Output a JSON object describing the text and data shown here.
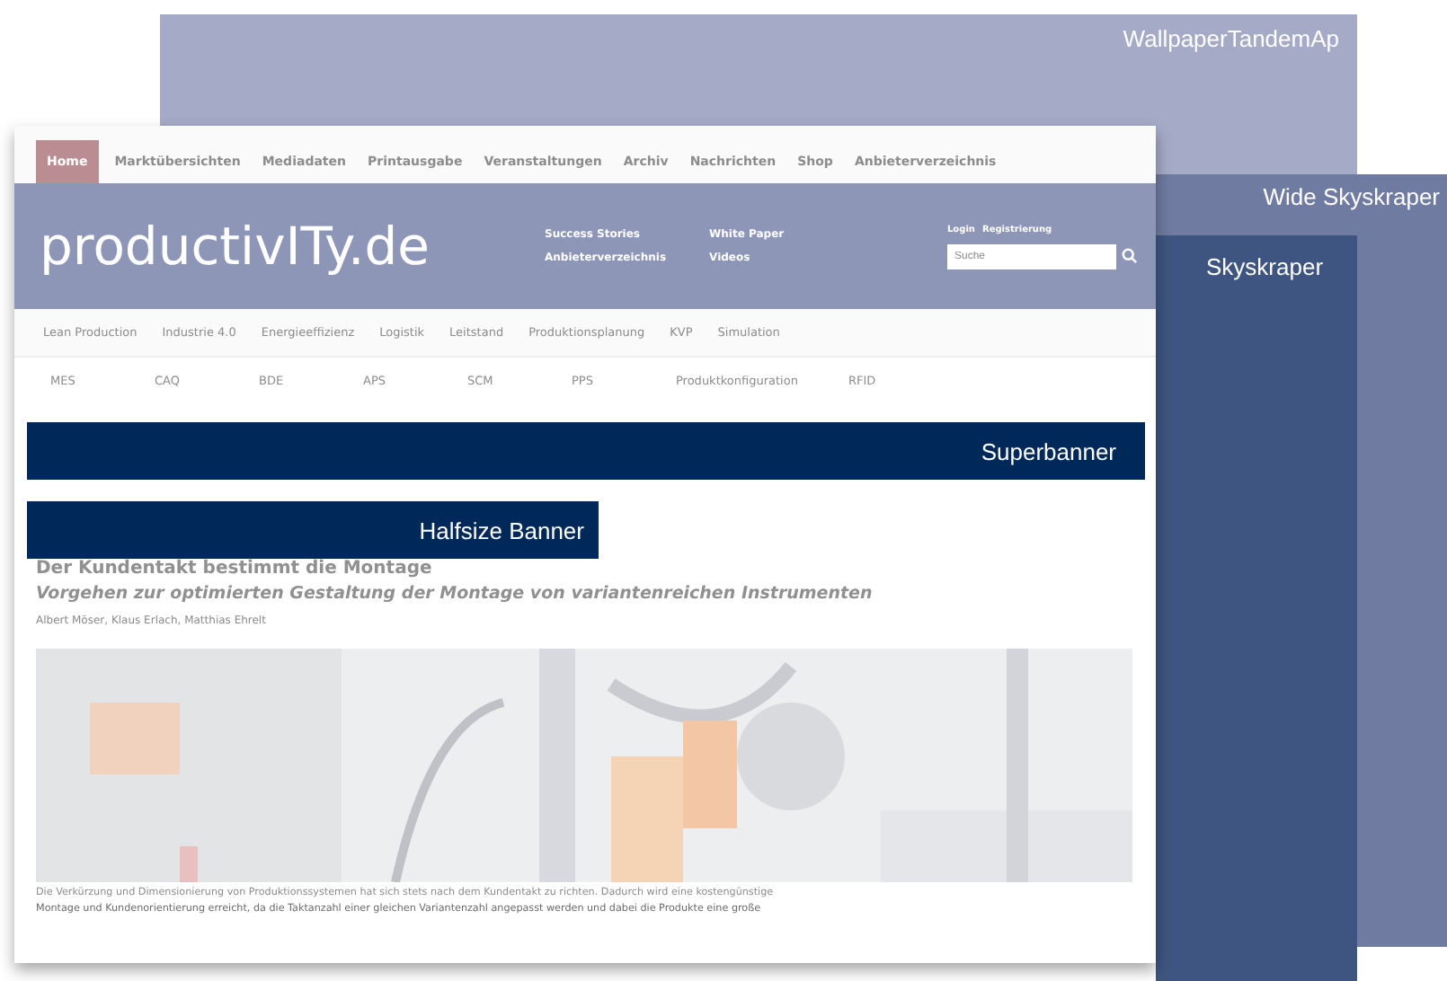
{
  "placements": [
    {
      "kind": "wallpaper",
      "label": "WallpaperTandemAp"
    },
    {
      "kind": "wide",
      "label": "Wide Skyskraper"
    },
    {
      "kind": "sky",
      "label": "Skyskraper"
    }
  ],
  "site": {
    "nav": [
      {
        "label": "Home",
        "selected": true
      },
      {
        "label": "Marktübersichten",
        "selected": false
      },
      {
        "label": "Mediadaten",
        "selected": false
      },
      {
        "label": "Printausgabe",
        "selected": false
      },
      {
        "label": "Veranstaltungen",
        "selected": false
      },
      {
        "label": "Archiv",
        "selected": false
      },
      {
        "label": "Nachrichten",
        "selected": false
      },
      {
        "label": "Shop",
        "selected": false
      },
      {
        "label": "Anbieterverzeichnis",
        "selected": false
      }
    ],
    "logo": "productivITy.de",
    "header_links": [
      "Success Stories",
      "White Paper",
      "Anbieterverzeichnis",
      "Videos"
    ],
    "account_links": [
      "Login",
      "Registrierung"
    ],
    "search": {
      "placeholder": "Suche"
    },
    "categories": [
      "Lean Production",
      "Industrie 4.0",
      "Energieeffizienz",
      "Logistik",
      "Leitstand",
      "Produktionsplanung",
      "KVP",
      "Simulation"
    ],
    "topics": [
      "MES",
      "CAQ",
      "BDE",
      "APS",
      "SCM",
      "PPS",
      "Produktkonfiguration",
      "RFID"
    ],
    "title": "Der Kundentakt bestimmt die Montage",
    "subtitle": "Vorgehen zur optimierten Gestaltung der Montage von variantenreichen Instrumenten",
    "authors": "Albert Möser, Klaus Erlach, Matthias Ehrelt",
    "body": [
      "Die Verkürzung und Dimensionierung von Produktionssystemen hat sich stets nach dem Kundentakt zu richten. Dadurch wird eine kostengünstige",
      "Montage und Kundenorientierung erreicht, da die Taktanzahl einer gleichen Variantenzahl angepasst werden und dabei die Produkte eine große"
    ]
  },
  "banners": [
    {
      "kind": "super",
      "label": "Superbanner"
    },
    {
      "kind": "half",
      "label": "Halfsize Banner"
    }
  ]
}
